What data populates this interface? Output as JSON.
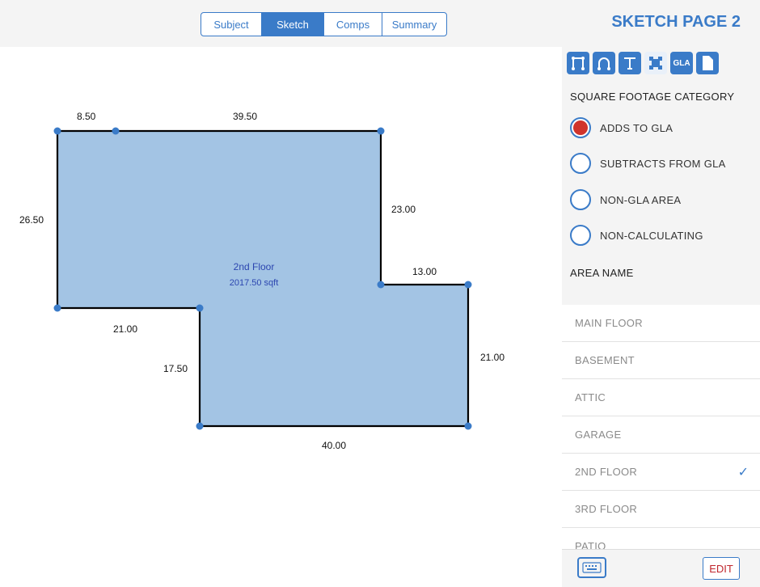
{
  "header": {
    "tabs": [
      {
        "label": "Subject",
        "active": false
      },
      {
        "label": "Sketch",
        "active": true
      },
      {
        "label": "Comps",
        "active": false
      },
      {
        "label": "Summary",
        "active": false
      }
    ],
    "page_title": "SKETCH PAGE 2"
  },
  "sketch": {
    "area_name": "2nd Floor",
    "area_size": "2017.50 sqft",
    "fill_color": "#a3c4e4",
    "dimensions": {
      "top_left": "8.50",
      "top_main": "39.50",
      "left": "26.50",
      "right_upper": "23.00",
      "step_top": "13.00",
      "bottom_left": "21.00",
      "inner_left": "17.50",
      "right_lower": "21.00",
      "bottom": "40.00"
    }
  },
  "toolbar": {
    "tools": [
      "line-tool-icon",
      "arc-tool-icon",
      "text-tool-icon",
      "area-tool-icon",
      "gla-tool-icon",
      "document-icon"
    ],
    "gla_label": "GLA"
  },
  "sidebar": {
    "category_heading": "SQUARE FOOTAGE CATEGORY",
    "categories": [
      {
        "label": "ADDS TO GLA",
        "selected": true
      },
      {
        "label": "SUBTRACTS FROM GLA",
        "selected": false
      },
      {
        "label": "NON-GLA AREA",
        "selected": false
      },
      {
        "label": "NON-CALCULATING",
        "selected": false
      }
    ],
    "area_heading": "AREA NAME",
    "areas": [
      {
        "label": "MAIN FLOOR",
        "checked": false
      },
      {
        "label": "BASEMENT",
        "checked": false
      },
      {
        "label": "ATTIC",
        "checked": false
      },
      {
        "label": "GARAGE",
        "checked": false
      },
      {
        "label": "2ND FLOOR",
        "checked": true
      },
      {
        "label": "3RD FLOOR",
        "checked": false
      },
      {
        "label": "PATIO",
        "checked": false
      }
    ],
    "check_mark": "✓",
    "edit_label": "EDIT"
  },
  "colors": {
    "accent": "#3a7bc8",
    "selected_radio": "#d0342c",
    "edit_text": "#c0262d"
  }
}
